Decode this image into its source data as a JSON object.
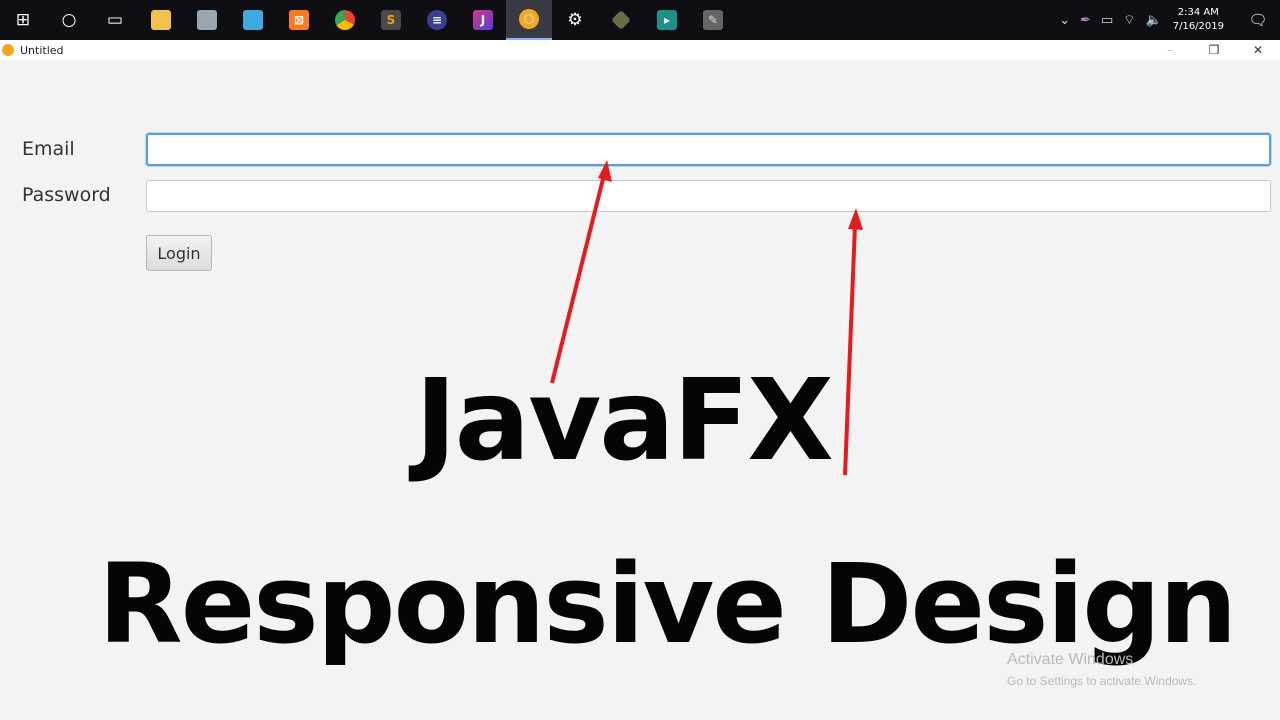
{
  "taskbar": {
    "apps": [
      {
        "name": "windows-start",
        "glyph": "⊞"
      },
      {
        "name": "cortana",
        "glyph": "○"
      },
      {
        "name": "task-view",
        "glyph": "▭"
      },
      {
        "name": "file-explorer",
        "glyph": "",
        "color": "#f2c14e"
      },
      {
        "name": "printer-app",
        "glyph": "",
        "color": "#9aa6b2"
      },
      {
        "name": "office-app",
        "glyph": "",
        "color": "#3fa9e0"
      },
      {
        "name": "xampp-app",
        "glyph": "",
        "color": "#fb7a24"
      },
      {
        "name": "chrome-app",
        "glyph": "",
        "color": "#e94335"
      },
      {
        "name": "sublime-app",
        "glyph": "",
        "color": "#f59e1b"
      },
      {
        "name": "eclipse-app",
        "glyph": "",
        "color": "#3b3f8f"
      },
      {
        "name": "intellij-app",
        "glyph": "",
        "color": "#d9348a"
      },
      {
        "name": "scenebuilder-app",
        "glyph": "",
        "color": "#f5a623",
        "active": true
      },
      {
        "name": "settings-app",
        "glyph": "⚙"
      },
      {
        "name": "tool-app",
        "glyph": "",
        "color": "#c2c27a"
      },
      {
        "name": "media-app",
        "glyph": "",
        "color": "#1f8f8a"
      },
      {
        "name": "paint-app",
        "glyph": "",
        "color": "#bbbbbb"
      }
    ],
    "clock": {
      "time": "2:34 AM",
      "date": "7/16/2019"
    }
  },
  "window": {
    "title": "Untitled"
  },
  "form": {
    "email_label": "Email",
    "password_label": "Password",
    "email_value": "",
    "password_value": "",
    "login_label": "Login"
  },
  "overlay": {
    "line1": "JavaFX",
    "line2": "Responsive Design",
    "arrow_color": "#e51c1c"
  },
  "watermark": {
    "line1": "Activate Windows",
    "line2": "Go to Settings to activate Windows."
  }
}
